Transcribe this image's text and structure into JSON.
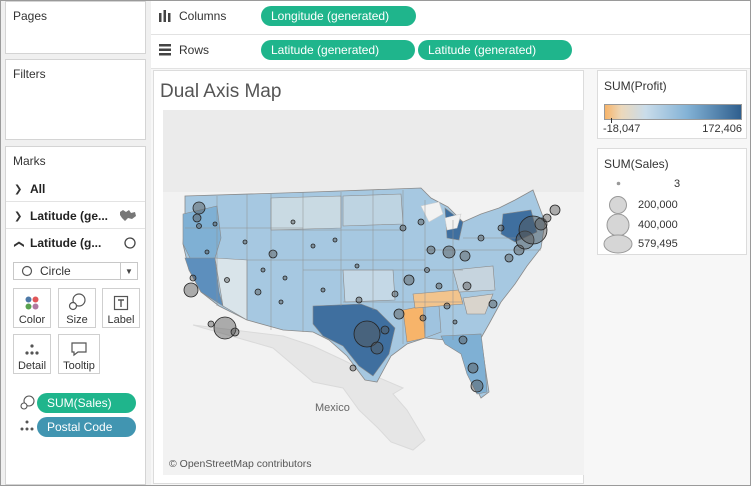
{
  "left_panel": {
    "pages": {
      "title": "Pages"
    },
    "filters": {
      "title": "Filters"
    },
    "marks": {
      "title": "Marks",
      "rows": [
        {
          "label": "All",
          "icon": "none"
        },
        {
          "label": "Latitude (ge...",
          "icon": "map-icon"
        },
        {
          "label": "Latitude (g...",
          "icon": "circle-icon"
        }
      ],
      "mark_type": "Circle",
      "buttons": [
        {
          "label": "Color",
          "icon": "color-icon"
        },
        {
          "label": "Size",
          "icon": "size-icon"
        },
        {
          "label": "Label",
          "icon": "label-icon"
        },
        {
          "label": "Detail",
          "icon": "detail-icon"
        },
        {
          "label": "Tooltip",
          "icon": "tooltip-icon"
        }
      ],
      "fields": [
        {
          "label": "SUM(Sales)",
          "icon": "size-icon",
          "color": "#1fb58c"
        },
        {
          "label": "Postal Code",
          "icon": "detail-icon",
          "color": "#4195b1"
        }
      ]
    }
  },
  "shelves": {
    "columns": {
      "label": "Columns",
      "icon": "columns-icon",
      "pills": [
        "Longitude (generated)"
      ]
    },
    "rows": {
      "label": "Rows",
      "icon": "rows-icon",
      "pills": [
        "Latitude (generated)",
        "Latitude (generated)"
      ]
    }
  },
  "sheet": {
    "title": "Dual Axis Map",
    "map": {
      "country_label": "Mexico",
      "attribution": "© OpenStreetMap contributors"
    }
  },
  "legends": {
    "profit": {
      "title": "SUM(Profit)",
      "min": "-18,047",
      "max": "172,406",
      "colors": [
        "#f7b46a",
        "#ecd8bb",
        "#c9dcea",
        "#84b3d6",
        "#2f5f8e"
      ]
    },
    "sales": {
      "title": "SUM(Sales)",
      "items": [
        "3",
        "200,000",
        "400,000",
        "579,495"
      ]
    }
  }
}
